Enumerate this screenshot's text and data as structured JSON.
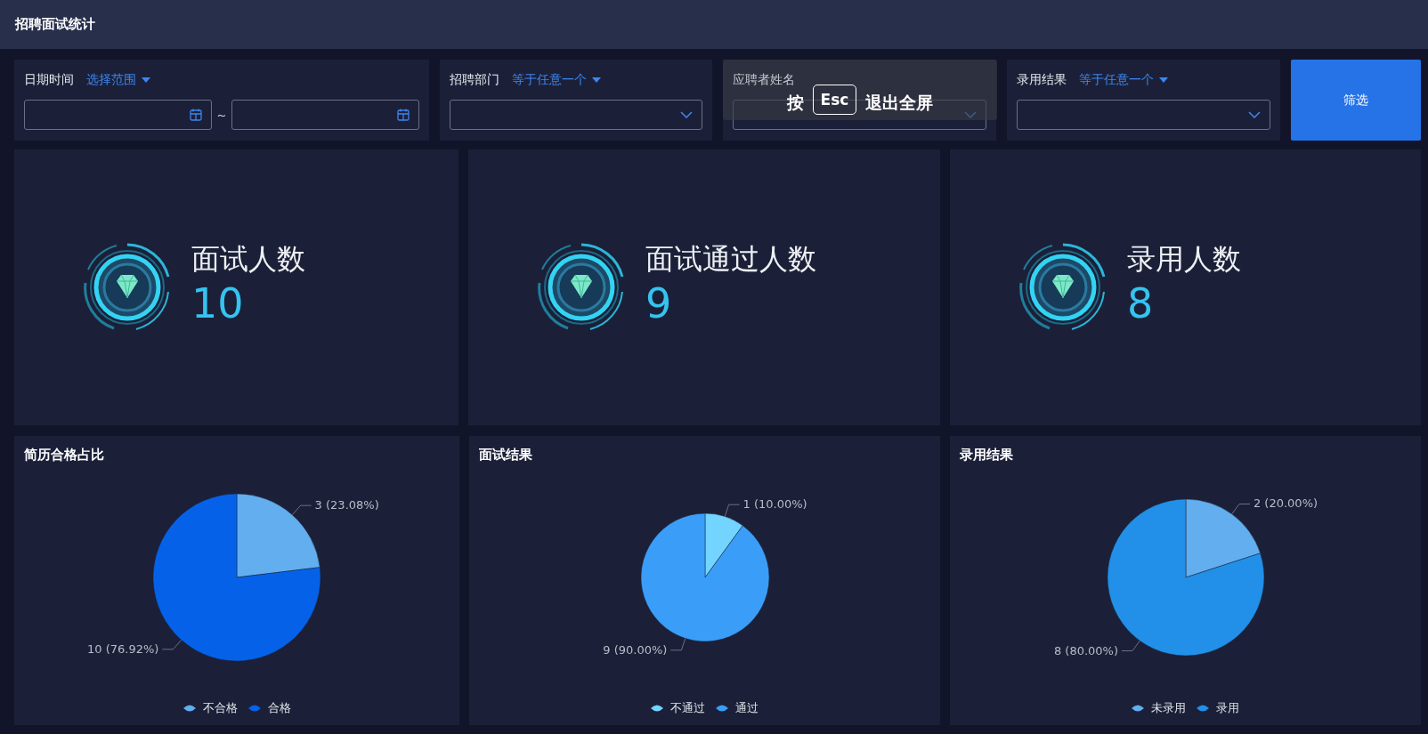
{
  "header": {
    "title": "招聘面试统计"
  },
  "filters": [
    {
      "kind": "date_range",
      "label": "日期时间",
      "operator": "选择范围",
      "separator": "~"
    },
    {
      "kind": "select",
      "label": "招聘部门",
      "operator": "等于任意一个"
    },
    {
      "kind": "select",
      "label": "应聘者姓名"
    },
    {
      "kind": "select",
      "label": "录用结果",
      "operator": "等于任意一个"
    }
  ],
  "filter_button": "筛选",
  "fullscreen_notice": {
    "prefix": "按",
    "key": "Esc",
    "text": "退出全屏"
  },
  "stats": [
    {
      "label": "面试人数",
      "value": "10"
    },
    {
      "label": "面试通过人数",
      "value": "9"
    },
    {
      "label": "录用人数",
      "value": "8"
    }
  ],
  "charts": [
    {
      "title": "简历合格占比",
      "legend": [
        {
          "color": "#62aeee"
        },
        {
          "color": "#0562e8"
        }
      ],
      "chart_data": {
        "type": "pie",
        "categories": [
          "不合格",
          "合格"
        ],
        "values": [
          3,
          10
        ],
        "value_labels": [
          "3 (23.08%)",
          "10 (76.92%)"
        ]
      }
    },
    {
      "title": "面试结果",
      "legend": [
        {
          "color": "#73d4ff"
        },
        {
          "color": "#3a9ef8"
        }
      ],
      "chart_data": {
        "type": "pie",
        "categories": [
          "不通过",
          "通过"
        ],
        "values": [
          1,
          9
        ],
        "value_labels": [
          "1 (10.00%)",
          "9 (90.00%)"
        ]
      }
    },
    {
      "title": "录用结果",
      "legend": [
        {
          "color": "#62aeee"
        },
        {
          "color": "#2290e8"
        }
      ],
      "chart_data": {
        "type": "pie",
        "categories": [
          "未录用",
          "录用"
        ],
        "values": [
          2,
          8
        ],
        "value_labels": [
          "2 (20.00%)",
          "8 (80.00%)"
        ]
      }
    }
  ]
}
